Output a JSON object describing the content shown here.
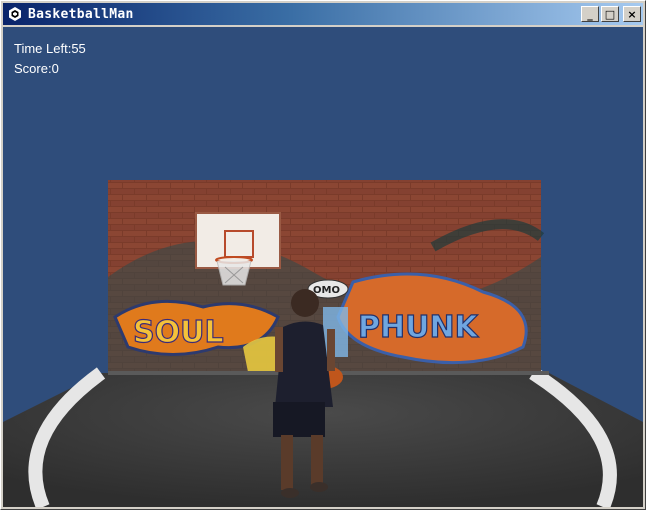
{
  "window": {
    "title": "BasketballMan",
    "controls": {
      "minimize": "_",
      "maximize": "□",
      "close": "×"
    }
  },
  "hud": {
    "time_left": "Time Left:55",
    "score": "Score:0"
  },
  "graffiti": {
    "left_word": "SOUL",
    "right_word": "PHUNK",
    "tag": "OMO"
  },
  "colors": {
    "sky": "#2f4d7b",
    "floor": "#3a3a3a",
    "court_line": "#e6e6e6",
    "brick": "#7a3b2a"
  }
}
